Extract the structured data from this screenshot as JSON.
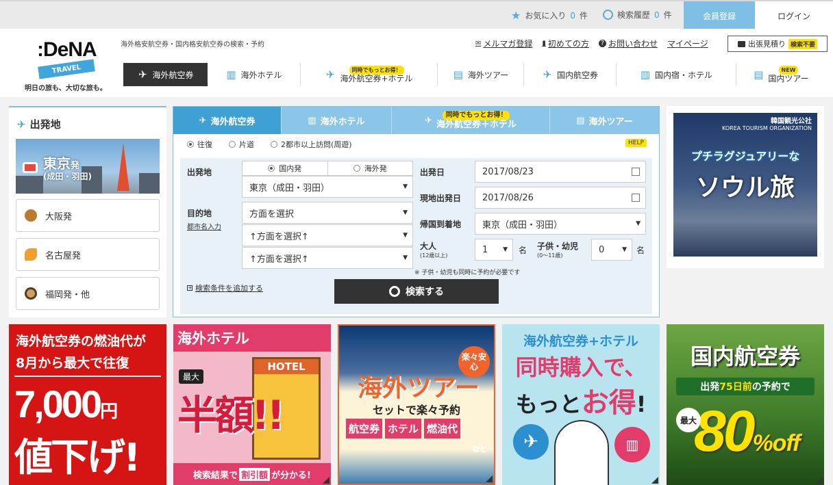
{
  "topbar": {
    "favorites_label": "お気に入り",
    "favorites_count": "0",
    "history_label": "検索履歴",
    "history_count": "0",
    "count_unit": "件",
    "register": "会員登録",
    "login": "ログイン"
  },
  "header": {
    "logo_text": ":DeNA",
    "logo_badge": "TRAVEL",
    "tagline": "明日の旅も、大切な旅も。",
    "subline": "海外格安航空券・国内格安航空券の検索・予約",
    "links": [
      "メルマガ登録",
      "初めての方",
      "お問い合わせ",
      "マイページ"
    ],
    "estimate": "出張見積り",
    "estimate_badge": "検索不要"
  },
  "nav": {
    "items": [
      {
        "label": "海外航空券",
        "pill": ""
      },
      {
        "label": "海外ホテル",
        "pill": ""
      },
      {
        "label": "海外航空券+ホテル",
        "pill": "同時でもっとお得！"
      },
      {
        "label": "海外ツアー",
        "pill": ""
      },
      {
        "label": "国内航空券",
        "pill": ""
      },
      {
        "label": "国内宿・ホテル",
        "pill": ""
      },
      {
        "label": "国内ツアー",
        "pill": "NEW"
      }
    ]
  },
  "departure": {
    "title": "出発地",
    "featured_city": "東京",
    "featured_suffix": "発",
    "featured_airports": "(成田・羽田)",
    "others": [
      "大阪発",
      "名古屋発",
      "福岡発・他"
    ]
  },
  "search": {
    "tabs": [
      {
        "label": "海外航空券",
        "pill": ""
      },
      {
        "label": "海外ホテル",
        "pill": ""
      },
      {
        "label": "海外航空券＋ホテル",
        "pill": "同時でもっとお得！"
      },
      {
        "label": "海外ツアー",
        "pill": ""
      }
    ],
    "trip_types": [
      "往復",
      "片道",
      "2都市以上訪問(周遊)"
    ],
    "help": "HELP",
    "origin_label": "出発地",
    "origin_domestic": "国内発",
    "origin_overseas": "海外発",
    "origin_value": "東京（成田・羽田）",
    "dest_label": "目的地",
    "dest_sublink": "都市名入力",
    "dest_values": [
      "方面を選択",
      "↑方面を選択↑",
      "↑方面を選択↑"
    ],
    "depart_label": "出発日",
    "depart_value": "2017/08/23",
    "return_label": "現地出発日",
    "return_value": "2017/08/26",
    "arrive_label": "帰国到着地",
    "arrive_value": "東京（成田・羽田）",
    "adult_label": "大人",
    "adult_sub": "(12歳以上)",
    "adult_value": "1",
    "child_label": "子供・幼児",
    "child_sub": "(0〜11歳)",
    "child_value": "0",
    "person_unit": "名",
    "note": "※ 子供・幼児も同時に予約が必要です",
    "add_condition": "検索条件を追加する",
    "search_button": "検索する"
  },
  "ad": {
    "line1": "プチラグジュアリーな",
    "line2": "ソウル旅",
    "sponsor": "韓国観光公社",
    "sponsor_en": "KOREA TOURISM ORGANIZATION"
  },
  "banners": {
    "fuel": {
      "l1": "海外航空券の燃油代が",
      "l2": "8月から最大で往復",
      "price": "7,000",
      "unit": "円",
      "l4": "値下げ!"
    },
    "hotel": {
      "title": "海外ホテル",
      "max": "最大",
      "half": "半額!!",
      "sign": "HOTEL",
      "bottom_a": "検索結果で",
      "bottom_hl": "割引額",
      "bottom_b": "が分かる!"
    },
    "tour": {
      "badge": "楽々安心",
      "title": "海外ツアー",
      "sub": "セットで楽々予約",
      "chips": [
        "航空券",
        "ホテル",
        "燃油代"
      ],
      "etc": "など"
    },
    "combo": {
      "l1": "海外航空券+ホテル",
      "l2": "同時購入で、",
      "l3a": "もっと",
      "l3b": "お得",
      "l3c": "!"
    },
    "domestic": {
      "title": "国内航空券",
      "sub_a": "出発",
      "sub_hl": "75日前",
      "sub_b": "の予約で",
      "max": "最大",
      "pct": "80",
      "pct_unit": "%off"
    }
  }
}
